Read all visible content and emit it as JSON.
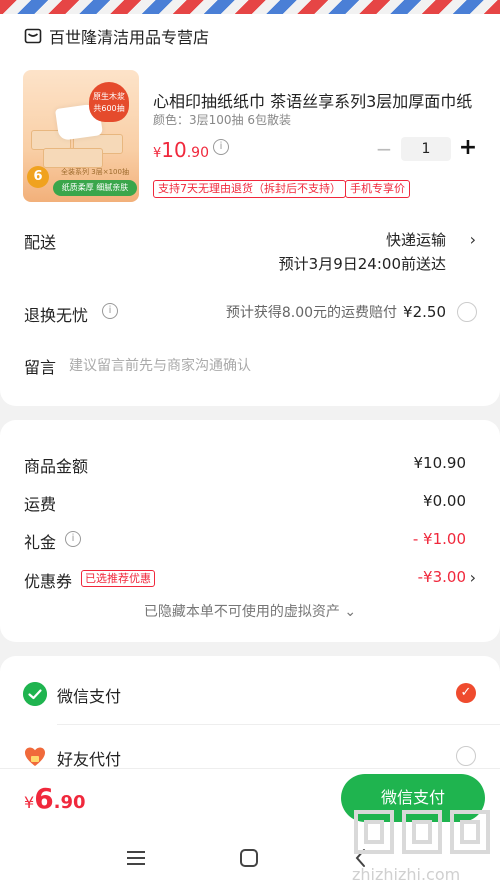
{
  "shop": {
    "name": "百世隆清洁用品专营店"
  },
  "product": {
    "title": "心相印抽纸纸巾 茶语丝享系列3层加厚面巾纸",
    "spec": "颜色：3层100抽 6包散装",
    "price": {
      "currency": "¥",
      "integer": "10",
      "decimal": ".90"
    },
    "quantity": "1",
    "tags": [
      "支持7天无理由退货（拆封后不支持）",
      "手机专享价"
    ],
    "image_text": {
      "hot": "原生木浆",
      "hot2": "共600抽",
      "badge": "6",
      "spec": "全装系列 3层×100抽",
      "slogan": "纸质柔厚 细腻亲肤"
    }
  },
  "delivery": {
    "label": "配送",
    "method": "快递运输",
    "eta": "预计3月9日24:00前送达"
  },
  "return": {
    "label": "退换无忧",
    "text": "预计获得8.00元的运费赔付",
    "price": "¥2.50"
  },
  "message": {
    "label": "留言",
    "placeholder": "建议留言前先与商家沟通确认"
  },
  "summary": {
    "goods_label": "商品金额",
    "goods_value": "¥10.90",
    "freight_label": "运费",
    "freight_value": "¥0.00",
    "gift_label": "礼金",
    "gift_value": "- ¥1.00",
    "coupon_label": "优惠券",
    "coupon_tag": "已选推荐优惠",
    "coupon_value": "-¥3.00",
    "hidden_assets": "已隐藏本单不可使用的虚拟资产 ⌄"
  },
  "payment": {
    "wechat_label": "微信支付",
    "friend_label": "好友代付"
  },
  "bottom": {
    "total": {
      "currency": "¥",
      "integer": "6",
      "decimal": ".90"
    },
    "pay_button": "微信支付"
  },
  "colors": {
    "accent_red": "#f0283c",
    "wechat_green": "#1fb44f"
  }
}
